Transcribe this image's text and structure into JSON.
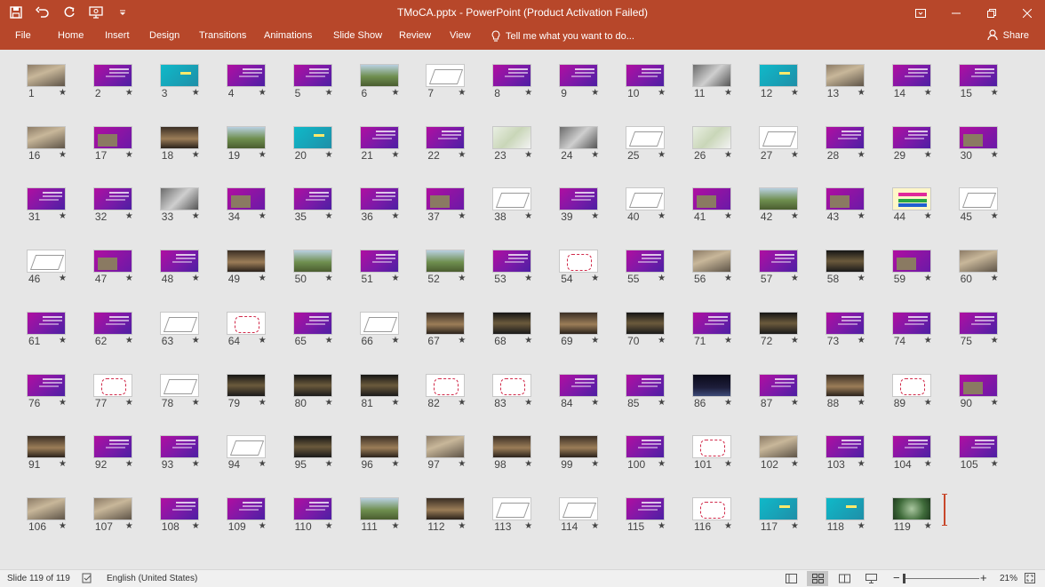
{
  "titlebar": {
    "title": "TMoCA.pptx - PowerPoint (Product Activation Failed)",
    "qat_icons": [
      "save-icon",
      "undo-icon",
      "redo-icon",
      "start-from-beginning-icon",
      "customize-qat-icon"
    ],
    "window_controls": [
      "ribbon-display-options-icon",
      "minimize-icon",
      "restore-icon",
      "close-icon"
    ]
  },
  "ribbon": {
    "tabs": [
      "File",
      "Home",
      "Insert",
      "Design",
      "Transitions",
      "Animations",
      "Slide Show",
      "Review",
      "View"
    ],
    "tell_me": "Tell me what you want to do...",
    "share": "Share"
  },
  "slides": [
    {
      "n": "1",
      "t": "photo"
    },
    {
      "n": "2",
      "t": "purple"
    },
    {
      "n": "3",
      "t": "teal"
    },
    {
      "n": "4",
      "t": "purple"
    },
    {
      "n": "5",
      "t": "purple"
    },
    {
      "n": "6",
      "t": "green"
    },
    {
      "n": "7",
      "t": "plan"
    },
    {
      "n": "8",
      "t": "purple"
    },
    {
      "n": "9",
      "t": "purple"
    },
    {
      "n": "10",
      "t": "purple"
    },
    {
      "n": "11",
      "t": "grey"
    },
    {
      "n": "12",
      "t": "teal"
    },
    {
      "n": "13",
      "t": "photo"
    },
    {
      "n": "14",
      "t": "purple"
    },
    {
      "n": "15",
      "t": "purple"
    },
    {
      "n": "16",
      "t": "photo"
    },
    {
      "n": "17",
      "t": "purple-pic"
    },
    {
      "n": "18",
      "t": "photo2"
    },
    {
      "n": "19",
      "t": "green"
    },
    {
      "n": "20",
      "t": "teal"
    },
    {
      "n": "21",
      "t": "purple"
    },
    {
      "n": "22",
      "t": "purple"
    },
    {
      "n": "23",
      "t": "map"
    },
    {
      "n": "24",
      "t": "grey"
    },
    {
      "n": "25",
      "t": "plan"
    },
    {
      "n": "26",
      "t": "map"
    },
    {
      "n": "27",
      "t": "plan"
    },
    {
      "n": "28",
      "t": "purple"
    },
    {
      "n": "29",
      "t": "purple"
    },
    {
      "n": "30",
      "t": "purple-pic"
    },
    {
      "n": "31",
      "t": "purple"
    },
    {
      "n": "32",
      "t": "purple"
    },
    {
      "n": "33",
      "t": "grey"
    },
    {
      "n": "34",
      "t": "purple-pic"
    },
    {
      "n": "35",
      "t": "purple"
    },
    {
      "n": "36",
      "t": "purple"
    },
    {
      "n": "37",
      "t": "purple-pic"
    },
    {
      "n": "38",
      "t": "plan"
    },
    {
      "n": "39",
      "t": "purple"
    },
    {
      "n": "40",
      "t": "plan"
    },
    {
      "n": "41",
      "t": "purple-pic"
    },
    {
      "n": "42",
      "t": "green"
    },
    {
      "n": "43",
      "t": "purple-pic"
    },
    {
      "n": "44",
      "t": "yellow"
    },
    {
      "n": "45",
      "t": "plan"
    },
    {
      "n": "46",
      "t": "plan"
    },
    {
      "n": "47",
      "t": "purple-pic"
    },
    {
      "n": "48",
      "t": "purple"
    },
    {
      "n": "49",
      "t": "photo2"
    },
    {
      "n": "50",
      "t": "green"
    },
    {
      "n": "51",
      "t": "purple"
    },
    {
      "n": "52",
      "t": "green"
    },
    {
      "n": "53",
      "t": "purple"
    },
    {
      "n": "54",
      "t": "plan-red"
    },
    {
      "n": "55",
      "t": "purple"
    },
    {
      "n": "56",
      "t": "photo"
    },
    {
      "n": "57",
      "t": "purple"
    },
    {
      "n": "58",
      "t": "dark"
    },
    {
      "n": "59",
      "t": "purple-pic"
    },
    {
      "n": "60",
      "t": "photo"
    },
    {
      "n": "61",
      "t": "purple"
    },
    {
      "n": "62",
      "t": "purple"
    },
    {
      "n": "63",
      "t": "plan"
    },
    {
      "n": "64",
      "t": "plan-red"
    },
    {
      "n": "65",
      "t": "purple"
    },
    {
      "n": "66",
      "t": "plan"
    },
    {
      "n": "67",
      "t": "photo2"
    },
    {
      "n": "68",
      "t": "dark"
    },
    {
      "n": "69",
      "t": "photo2"
    },
    {
      "n": "70",
      "t": "dark"
    },
    {
      "n": "71",
      "t": "purple"
    },
    {
      "n": "72",
      "t": "dark"
    },
    {
      "n": "73",
      "t": "purple"
    },
    {
      "n": "74",
      "t": "purple"
    },
    {
      "n": "75",
      "t": "purple"
    },
    {
      "n": "76",
      "t": "purple"
    },
    {
      "n": "77",
      "t": "plan-red"
    },
    {
      "n": "78",
      "t": "plan"
    },
    {
      "n": "79",
      "t": "dark"
    },
    {
      "n": "80",
      "t": "dark"
    },
    {
      "n": "81",
      "t": "dark"
    },
    {
      "n": "82",
      "t": "plan-red"
    },
    {
      "n": "83",
      "t": "plan-red"
    },
    {
      "n": "84",
      "t": "purple"
    },
    {
      "n": "85",
      "t": "purple"
    },
    {
      "n": "86",
      "t": "night"
    },
    {
      "n": "87",
      "t": "purple"
    },
    {
      "n": "88",
      "t": "photo2"
    },
    {
      "n": "89",
      "t": "plan-red"
    },
    {
      "n": "90",
      "t": "purple-pic"
    },
    {
      "n": "91",
      "t": "photo2"
    },
    {
      "n": "92",
      "t": "purple"
    },
    {
      "n": "93",
      "t": "purple"
    },
    {
      "n": "94",
      "t": "plan"
    },
    {
      "n": "95",
      "t": "dark"
    },
    {
      "n": "96",
      "t": "photo2"
    },
    {
      "n": "97",
      "t": "photo"
    },
    {
      "n": "98",
      "t": "photo2"
    },
    {
      "n": "99",
      "t": "photo2"
    },
    {
      "n": "100",
      "t": "purple"
    },
    {
      "n": "101",
      "t": "plan-red"
    },
    {
      "n": "102",
      "t": "photo"
    },
    {
      "n": "103",
      "t": "purple"
    },
    {
      "n": "104",
      "t": "purple"
    },
    {
      "n": "105",
      "t": "purple"
    },
    {
      "n": "106",
      "t": "photo"
    },
    {
      "n": "107",
      "t": "photo"
    },
    {
      "n": "108",
      "t": "purple"
    },
    {
      "n": "109",
      "t": "purple"
    },
    {
      "n": "110",
      "t": "purple"
    },
    {
      "n": "111",
      "t": "green"
    },
    {
      "n": "112",
      "t": "photo2"
    },
    {
      "n": "113",
      "t": "plan"
    },
    {
      "n": "114",
      "t": "plan"
    },
    {
      "n": "115",
      "t": "purple"
    },
    {
      "n": "116",
      "t": "plan-red"
    },
    {
      "n": "117",
      "t": "teal"
    },
    {
      "n": "118",
      "t": "teal"
    },
    {
      "n": "119",
      "t": "moss"
    }
  ],
  "star_glyph": "★",
  "statusbar": {
    "slide_info": "Slide 119 of 119",
    "language": "English (United States)",
    "zoom": "21%",
    "zoom_minus": "−",
    "zoom_plus": "+"
  },
  "colors": {
    "accent": "#b7472a",
    "slide_gradient_start": "#b00ea0",
    "slide_gradient_end": "#4d1fa3",
    "teal": "#0fb9c9"
  }
}
